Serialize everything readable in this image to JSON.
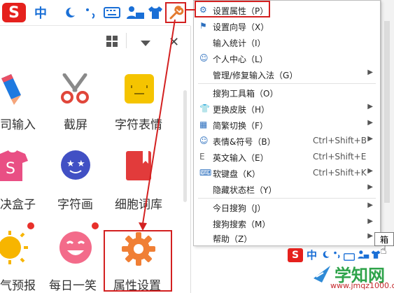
{
  "toolbar": {
    "logo_glyph": "S",
    "lang_glyph": "中",
    "icons": [
      "sogou-logo-icon",
      "language-chinese-icon",
      "moon-icon",
      "punctuation-icon",
      "keyboard-icon",
      "user-icon",
      "shirt-icon",
      "wrench-icon"
    ]
  },
  "panel": {
    "tiles": [
      {
        "label": "司输入",
        "icon": "pen-icon",
        "color": "#1e7ae0"
      },
      {
        "label": "截屏",
        "icon": "scissors-icon",
        "color": "#e0463a"
      },
      {
        "label": "字符表情",
        "icon": "emoticon-icon",
        "color": "#f5c400"
      },
      {
        "label": "决盒子",
        "icon": "t-shirt-box-icon",
        "color": "#e94f84"
      },
      {
        "label": "字符画",
        "icon": "star-face-icon",
        "color": "#4150c4"
      },
      {
        "label": "细胞词库",
        "icon": "book-icon",
        "color": "#e23b3b"
      },
      {
        "label": "气预报",
        "icon": "sun-icon",
        "color": "#f7b500"
      },
      {
        "label": "每日一笑",
        "icon": "smile-icon",
        "color": "#f36b8a"
      },
      {
        "label": "属性设置",
        "icon": "gear-icon",
        "color": "#f07f35"
      }
    ]
  },
  "menu": {
    "items": [
      {
        "label": "设置属性（P）",
        "shortcut": "",
        "submenu": false,
        "icon": "gear-icon"
      },
      {
        "label": "设置向导（X）",
        "shortcut": "",
        "submenu": false,
        "icon": "flag-icon"
      },
      {
        "label": "输入统计（I）",
        "shortcut": "",
        "submenu": false,
        "icon": ""
      },
      {
        "label": "个人中心（L）",
        "shortcut": "",
        "submenu": false,
        "icon": "person-icon"
      },
      {
        "label": "管理/修复输入法（G）",
        "shortcut": "",
        "submenu": true,
        "icon": ""
      },
      {
        "label": "搜狗工具箱（O）",
        "shortcut": "",
        "submenu": false,
        "icon": ""
      },
      {
        "label": "更换皮肤（H）",
        "shortcut": "",
        "submenu": true,
        "icon": "shirt-icon"
      },
      {
        "label": "简繁切换（F）",
        "shortcut": "",
        "submenu": true,
        "icon": "convert-icon"
      },
      {
        "label": "表情&符号（B）",
        "shortcut": "Ctrl+Shift+B",
        "submenu": true,
        "icon": "smiley-icon"
      },
      {
        "label": "英文输入（E）",
        "shortcut": "Ctrl+Shift+E",
        "submenu": false,
        "icon": "letter-e-icon"
      },
      {
        "label": "软键盘（K）",
        "shortcut": "Ctrl+Shift+K",
        "submenu": true,
        "icon": "keyboard-icon"
      },
      {
        "label": "隐藏状态栏（Y）",
        "shortcut": "",
        "submenu": true,
        "icon": ""
      },
      {
        "label": "今日搜狗（J）",
        "shortcut": "",
        "submenu": true,
        "icon": ""
      },
      {
        "label": "搜狗搜索（M）",
        "shortcut": "",
        "submenu": true,
        "icon": ""
      },
      {
        "label": "帮助（Z）",
        "shortcut": "",
        "submenu": true,
        "icon": ""
      }
    ]
  },
  "tooltip": "箱",
  "mini_toolbar": {
    "logo_glyph": "S",
    "lang_glyph": "中"
  },
  "watermark": {
    "text": "学知网",
    "url": "www.jmqz1000.com"
  }
}
